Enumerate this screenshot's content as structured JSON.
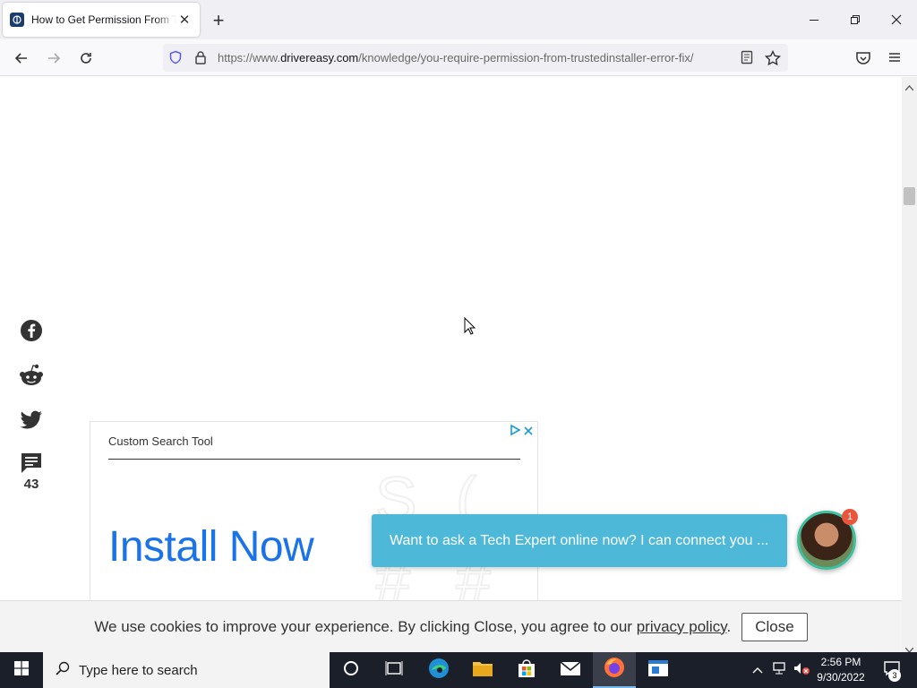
{
  "browser": {
    "tab_title": "How to Get Permission From TrustedInstaller",
    "tab_close": "✕",
    "new_tab": "+",
    "url_prefix": "https://www.",
    "url_host": "drivereasy.com",
    "url_path": "/knowledge/you-require-permission-from-trustedinstaller-error-fix/",
    "window_controls": {
      "minimize": "—",
      "restore": "❐",
      "close": "✕"
    }
  },
  "share": {
    "facebook_icon": "facebook-icon",
    "reddit_icon": "reddit-icon",
    "twitter_icon": "twitter-icon",
    "comments_icon": "comments-icon",
    "comments_count": "43"
  },
  "ad": {
    "label": "Custom Search Tool",
    "cta": "Install Now",
    "close": "✕"
  },
  "chat": {
    "message": "Want to ask a Tech Expert online now? I can connect you ...",
    "badge_count": "1"
  },
  "cookie": {
    "text": "We use cookies to improve your experience. By clicking Close, you agree to our",
    "link_text": "privacy policy",
    "period": ".",
    "close_label": "Close"
  },
  "taskbar": {
    "search_placeholder": "Type here to search",
    "clock_time": "2:56 PM",
    "clock_date": "9/30/2022",
    "notification_count": "3"
  },
  "colors": {
    "chat_bubble": "#4db8d8",
    "ad_cta": "#1a73e8",
    "taskbar": "#1b1f2a"
  }
}
